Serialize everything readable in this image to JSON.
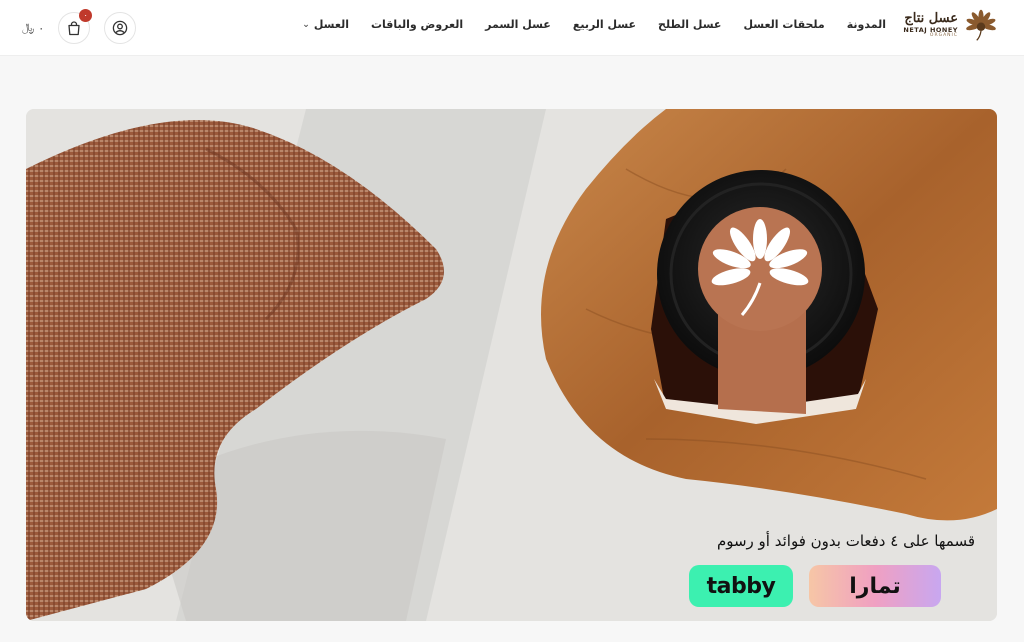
{
  "brand": {
    "name_ar": "عسل نتاج",
    "name_en": "NETAJ HONEY",
    "sub": "ORGANIC",
    "logo_icon": "flower-logo-icon"
  },
  "nav": {
    "items": [
      {
        "label": "العسل",
        "has_dropdown": true
      },
      {
        "label": "العروض والباقات"
      },
      {
        "label": "عسل السمر"
      },
      {
        "label": "عسل الربيع"
      },
      {
        "label": "عسل الطلح"
      },
      {
        "label": "ملحقات العسل"
      },
      {
        "label": "المدونة"
      }
    ]
  },
  "header_actions": {
    "currency_symbol": "﷼",
    "cart_total": "٠",
    "cart_count": "٠",
    "cart_icon": "shopping-bag-icon",
    "account_icon": "user-icon"
  },
  "hero": {
    "promo_text": "قسمها على ٤ دفعات بدون فوائد أو رسوم",
    "payment_providers": [
      {
        "name": "tamara",
        "label": "تمارا"
      },
      {
        "name": "tabby",
        "label": "tabby"
      }
    ]
  },
  "colors": {
    "tabby_bg": "#3cf0b0",
    "badge": "#c0392b",
    "brand_brown": "#3a2a1c"
  }
}
